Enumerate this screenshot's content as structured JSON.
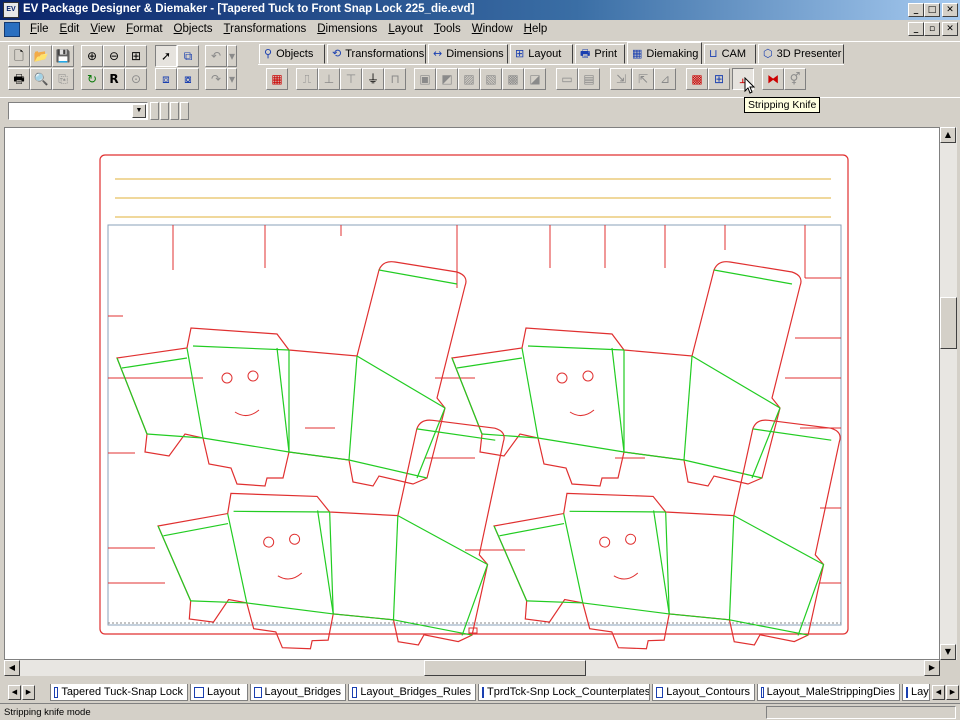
{
  "window": {
    "title": "EV Package Designer & Diemaker - [Tapered Tuck to Front Snap Lock 225_die.evd]",
    "app_icon": "EV"
  },
  "menu": [
    "File",
    "Edit",
    "View",
    "Format",
    "Objects",
    "Transformations",
    "Dimensions",
    "Layout",
    "Tools",
    "Window",
    "Help"
  ],
  "tabs": [
    {
      "label": "Objects",
      "icon": "objects-icon"
    },
    {
      "label": "Transformations",
      "icon": "transformations-icon"
    },
    {
      "label": "Dimensions",
      "icon": "dimensions-icon"
    },
    {
      "label": "Layout",
      "icon": "layout-icon"
    },
    {
      "label": "Print",
      "icon": "print-icon"
    },
    {
      "label": "Diemaking",
      "icon": "diemaking-icon",
      "active": true
    },
    {
      "label": "CAM",
      "icon": "cam-icon"
    },
    {
      "label": "3D Presenter",
      "icon": "3d-presenter-icon"
    }
  ],
  "tooltip": "Stripping Knife",
  "sheet_tabs": [
    "Tapered Tuck-Snap Lock",
    "Layout",
    "Layout_Bridges",
    "Layout_Bridges_Rules",
    "TprdTck-Snp Lock_Counterplates",
    "Layout_Contours",
    "Layout_MaleStrippingDies",
    "Layout"
  ],
  "status": "Stripping knife mode",
  "colors": {
    "die_cut": "#e03030",
    "crease": "#22cc22",
    "gripper": "#e8c060",
    "sheet_border": "#8aa0b8"
  }
}
